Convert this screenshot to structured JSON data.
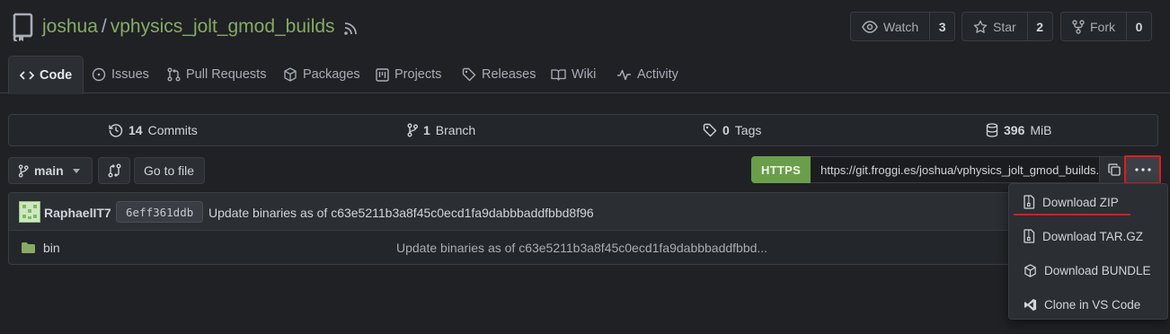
{
  "repo": {
    "owner": "joshua",
    "separator": "/",
    "name": "vphysics_jolt_gmod_builds"
  },
  "header_buttons": [
    {
      "label": "Watch",
      "count": "3",
      "icon": "eye-icon"
    },
    {
      "label": "Star",
      "count": "2",
      "icon": "star-icon"
    },
    {
      "label": "Fork",
      "count": "0",
      "icon": "fork-icon"
    }
  ],
  "tabs": [
    {
      "label": "Code",
      "icon": "code-icon",
      "active": true
    },
    {
      "label": "Issues",
      "icon": "issue-icon"
    },
    {
      "label": "Pull Requests",
      "icon": "pull-request-icon"
    },
    {
      "label": "Packages",
      "icon": "package-icon"
    },
    {
      "label": "Projects",
      "icon": "project-icon"
    },
    {
      "label": "Releases",
      "icon": "tag-icon"
    },
    {
      "label": "Wiki",
      "icon": "book-icon"
    },
    {
      "label": "Activity",
      "icon": "pulse-icon"
    }
  ],
  "stats": {
    "commits": {
      "count": "14",
      "label": "Commits"
    },
    "branches": {
      "count": "1",
      "label": "Branch"
    },
    "tags": {
      "count": "0",
      "label": "Tags"
    },
    "size": {
      "count": "396",
      "label": "MiB"
    }
  },
  "toolbar": {
    "branch": "main",
    "go_to_file": "Go to file",
    "clone_protocol": "HTTPS",
    "clone_url": "https://git.froggi.es/joshua/vphysics_jolt_gmod_builds.git"
  },
  "latest_commit": {
    "author": "RaphaelIT7",
    "sha": "6eff361ddb",
    "message": "Update binaries as of c63e5211b3a8f45c0ecd1fa9dabbbaddfbbd8f96"
  },
  "files": [
    {
      "name": "bin",
      "type": "folder",
      "commit": "Update binaries as of c63e5211b3a8f45c0ecd1fa9dabbbaddfbbd..."
    }
  ],
  "download_menu": [
    {
      "label": "Download ZIP",
      "icon": "file-zip-icon"
    },
    {
      "label": "Download TAR.GZ",
      "icon": "file-zip-icon"
    },
    {
      "label": "Download BUNDLE",
      "icon": "package-icon"
    },
    {
      "label": "Clone in VS Code",
      "icon": "vscode-icon"
    }
  ],
  "colors": {
    "accent": "#87ab63",
    "https_green": "#6b9e4a",
    "highlight_red": "#e01c1c",
    "background": "#1f2125"
  }
}
